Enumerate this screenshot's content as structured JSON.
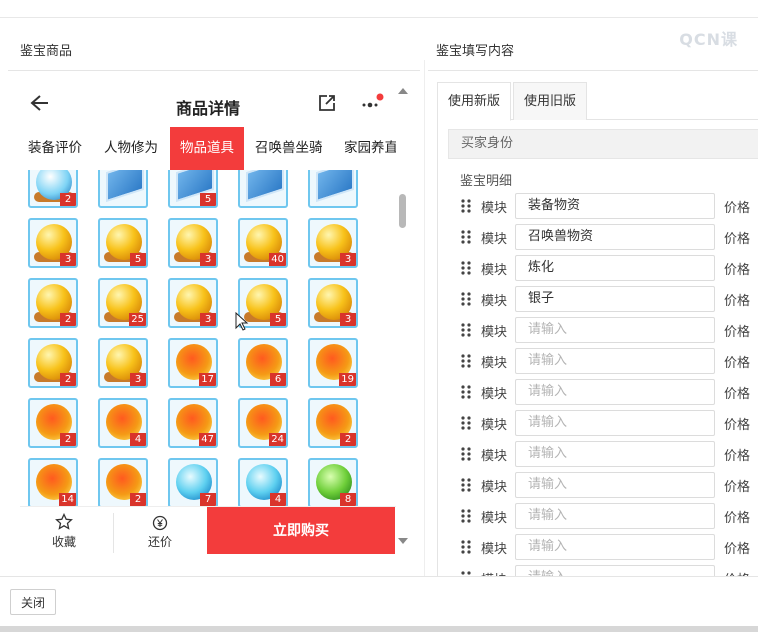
{
  "watermark": "QCN课",
  "left_panel": {
    "title": "鉴宝商品"
  },
  "right_panel": {
    "title": "鉴宝填写内容"
  },
  "phone": {
    "title": "商品详情",
    "tabs": [
      "装备评价",
      "人物修为",
      "物品道具",
      "召唤兽坐骑",
      "家园养直"
    ],
    "active_tab": "物品道具",
    "items": [
      {
        "type": "crystal",
        "count": "2"
      },
      {
        "type": "book",
        "count": ""
      },
      {
        "type": "book",
        "count": "5"
      },
      {
        "type": "book",
        "count": ""
      },
      {
        "type": "book",
        "count": ""
      },
      {
        "type": "gold",
        "count": "3"
      },
      {
        "type": "gold",
        "count": "5"
      },
      {
        "type": "gold",
        "count": "3"
      },
      {
        "type": "gold",
        "count": "40"
      },
      {
        "type": "gold",
        "count": "3"
      },
      {
        "type": "gold",
        "count": "2"
      },
      {
        "type": "gold",
        "count": "25"
      },
      {
        "type": "gold",
        "count": "3"
      },
      {
        "type": "gold",
        "count": "5"
      },
      {
        "type": "gold",
        "count": "3"
      },
      {
        "type": "gold",
        "count": "2"
      },
      {
        "type": "gold",
        "count": "3"
      },
      {
        "type": "fire",
        "count": "17"
      },
      {
        "type": "fire",
        "count": "6"
      },
      {
        "type": "fire",
        "count": "19"
      },
      {
        "type": "fire",
        "count": "2"
      },
      {
        "type": "fire",
        "count": "4"
      },
      {
        "type": "fire",
        "count": "47"
      },
      {
        "type": "fire",
        "count": "24"
      },
      {
        "type": "fire",
        "count": "2"
      },
      {
        "type": "fire",
        "count": "14"
      },
      {
        "type": "fire",
        "count": "2"
      },
      {
        "type": "blue",
        "count": "7"
      },
      {
        "type": "blue",
        "count": "4"
      },
      {
        "type": "green",
        "count": "8"
      }
    ],
    "favorite_label": "收藏",
    "counter_label": "还价",
    "buy_label": "立即购买"
  },
  "form": {
    "tabs": [
      "使用新版",
      "使用旧版"
    ],
    "active_tab": "使用新版",
    "buyer_section": "买家身份",
    "detail_label": "鉴宝明细",
    "module_label": "模块",
    "price_label": "价格",
    "placeholder": "请输入",
    "rows": [
      "装备物资",
      "召唤兽物资",
      "炼化",
      "银子",
      "",
      "",
      "",
      "",
      "",
      "",
      "",
      "",
      ""
    ]
  },
  "footer": {
    "close_label": "关闭"
  },
  "colors": {
    "accent": "#f33c3c",
    "badge": "#d9342b",
    "cell_border": "#6fc7ef"
  }
}
